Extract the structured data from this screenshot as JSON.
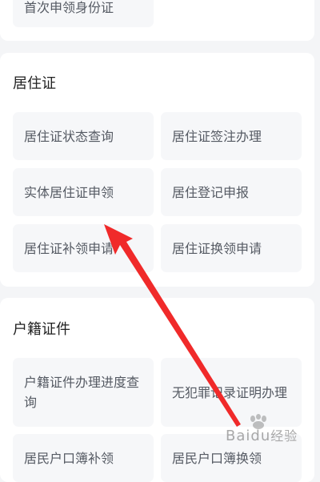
{
  "top_section": {
    "items": [
      "首次申领身份证"
    ]
  },
  "residence_section": {
    "title": "居住证",
    "items": [
      "居住证状态查询",
      "居住证签注办理",
      "实体居住证申领",
      "居住登记申报",
      "居住证补领申请",
      "居住证换领申请"
    ]
  },
  "household_section": {
    "title": "户籍证件",
    "items": [
      "户籍证件办理进度查询",
      "无犯罪记录证明办理",
      "居民户口簿补领",
      "居民户口簿换领"
    ]
  },
  "watermark": {
    "text_latin": "Bai",
    "text_mid": "du",
    "text_cn": "经验"
  },
  "colors": {
    "annotation_arrow": "#f02a2a",
    "accent_text": "#555a63"
  }
}
